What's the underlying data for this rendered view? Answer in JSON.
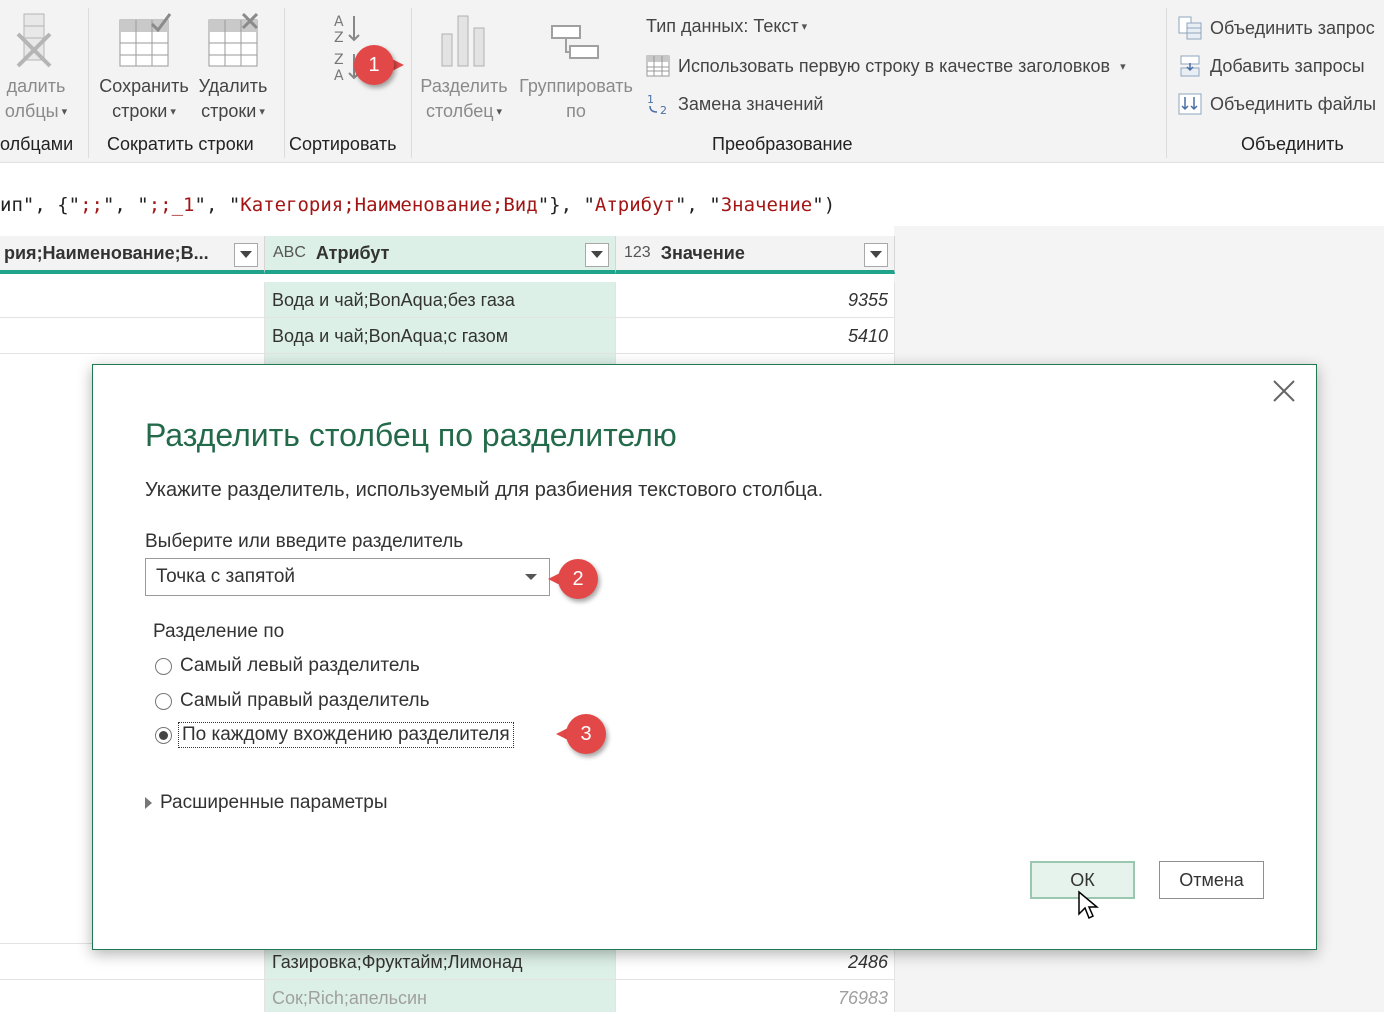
{
  "ribbon": {
    "delete_columns": {
      "line1": "далить",
      "line2": "олбцы"
    },
    "keep_rows": {
      "line1": "Сохранить",
      "line2": "строки"
    },
    "remove_rows": {
      "line1": "Удалить",
      "line2": "строки"
    },
    "split_column": {
      "line1": "Разделить",
      "line2": "столбец"
    },
    "group_by": {
      "line1": "Группировать",
      "line2": "по"
    },
    "data_type": "Тип данных: Текст",
    "use_first_row": "Использовать первую строку в качестве заголовков",
    "replace_values": "Замена значений",
    "merge_queries": "Объединить запрос",
    "append_queries": "Добавить запросы",
    "combine_files": "Объединить файлы",
    "groups": {
      "columns": "олбцами",
      "reduce_rows": "Сократить строки",
      "sort": "Сортировать",
      "transform": "Преобразование",
      "combine": "Объединить"
    }
  },
  "formula": {
    "p1": "ип\", {\"",
    "s1": ";;",
    "p2": "\", \"",
    "s2": ";;_1",
    "p3": "\", \"",
    "s3": "Категория;Наименование;Вид",
    "p4": "\"}, \"",
    "s4": "Атрибут",
    "p5": "\", \"",
    "s5": "Значение",
    "p6": "\")"
  },
  "grid": {
    "columns": [
      {
        "type": "",
        "name": "рия;Наименование;В..."
      },
      {
        "type": "ABC",
        "name": "Атрибут"
      },
      {
        "type": "123",
        "name": "Значение"
      }
    ],
    "rows_top": [
      {
        "attr": "Вода и чай;BonAqua;без газа",
        "value": "9355"
      },
      {
        "attr": "Вода и чай;BonAqua;с газом",
        "value": "5410"
      }
    ],
    "rows_bottom": [
      {
        "attr": "Газировка;Фруктайм;Лимонад",
        "value": "2486"
      },
      {
        "attr": "Сок;Rich;апельсин",
        "value": "76983"
      }
    ]
  },
  "callouts": [
    "1",
    "2",
    "3"
  ],
  "dialog": {
    "title": "Разделить столбец по разделителю",
    "description": "Укажите разделитель, используемый для разбиения текстового столбца.",
    "delimiter_label": "Выберите или введите разделитель",
    "delimiter_value": "Точка с запятой",
    "split_by_label": "Разделение по",
    "options": [
      "Самый левый разделитель",
      "Самый правый разделитель",
      "По каждому вхождению разделителя"
    ],
    "selected_option": "По каждому вхождению разделителя",
    "advanced": "Расширенные параметры",
    "ok": "ОК",
    "cancel": "Отмена"
  },
  "colors": {
    "accent": "#1fa38a",
    "title_green": "#236a4a",
    "callout_red": "#e34848",
    "string_red": "#a31515"
  },
  "icons": [
    "delete-columns-icon",
    "keep-rows-icon",
    "remove-rows-icon",
    "sort-asc-icon",
    "sort-desc-icon",
    "split-column-icon",
    "group-by-icon",
    "table-header-icon",
    "replace-values-icon",
    "merge-queries-icon",
    "append-queries-icon",
    "combine-files-icon",
    "filter-dropdown-icon",
    "close-icon",
    "mouse-cursor-icon"
  ]
}
